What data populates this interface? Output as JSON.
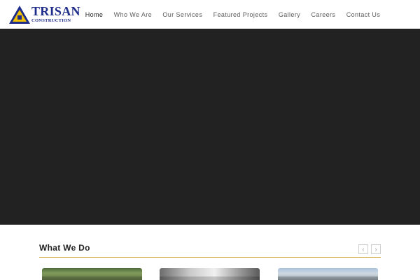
{
  "brand": {
    "name": "TRISAN",
    "tagline": "CONSTRUCTION",
    "colors": {
      "primary": "#1f2d8a",
      "accent": "#f2c200",
      "rule": "#c9a227"
    }
  },
  "nav": {
    "items": [
      {
        "label": "Home",
        "active": true
      },
      {
        "label": "Who We Are",
        "active": false
      },
      {
        "label": "Our Services",
        "active": false
      },
      {
        "label": "Featured Projects",
        "active": false
      },
      {
        "label": "Gallery",
        "active": false
      },
      {
        "label": "Careers",
        "active": false
      },
      {
        "label": "Contact Us",
        "active": false
      }
    ]
  },
  "hero": {
    "background": "#222222"
  },
  "section": {
    "title": "What We Do",
    "prev_icon": "chevron-left-icon",
    "next_icon": "chevron-right-icon",
    "prev_glyph": "‹",
    "next_glyph": "›"
  },
  "cards": [
    {
      "image": "landscaping-photo"
    },
    {
      "image": "truck-photo"
    },
    {
      "image": "road-photo"
    }
  ]
}
